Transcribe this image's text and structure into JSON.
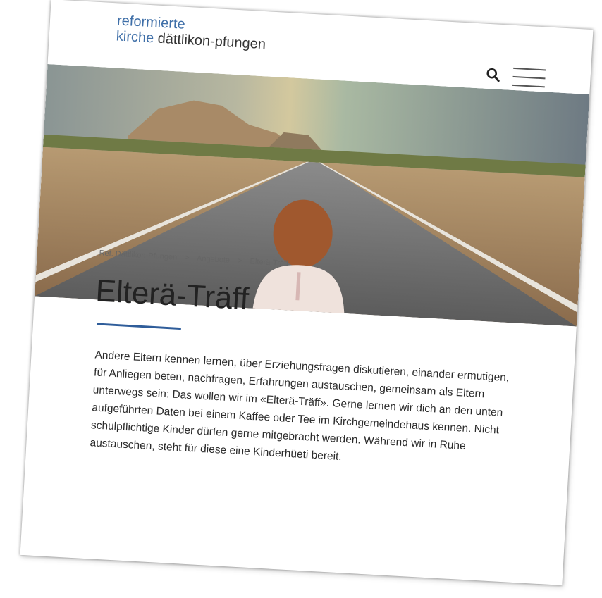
{
  "logo": {
    "line1": "reformierte",
    "line2_accent": "kirche",
    "line2_rest": "dättlikon-pfungen"
  },
  "header": {
    "search_icon": "search-icon",
    "menu_icon": "hamburger-menu-icon"
  },
  "breadcrumb": {
    "items": [
      "Ref. Dättlikon-Pfungen",
      "Angebote",
      "Elterä-Träff"
    ],
    "separator": ">"
  },
  "page": {
    "title": "Elterä-Träff",
    "body": "Andere Eltern kennen lernen, über Erziehungsfragen diskutieren, einander ermutigen, für Anliegen beten, nachfragen, Erfahrungen austauschen, gemeinsam als Eltern unterwegs sein: Das wollen wir im «Elterä-Träff». Gerne lernen wir dich an den unten aufgeführten Daten bei einem Kaffee oder Tee im Kirchgemeindehaus kennen. Nicht schulpflichtige Kinder dürfen gerne mitgebracht werden. Während wir in Ruhe austauschen, steht für diese eine Kinderhüeti bereit."
  },
  "colors": {
    "accent": "#3f6fa8",
    "rule": "#2f5d9a",
    "text": "#2a2a2a"
  }
}
